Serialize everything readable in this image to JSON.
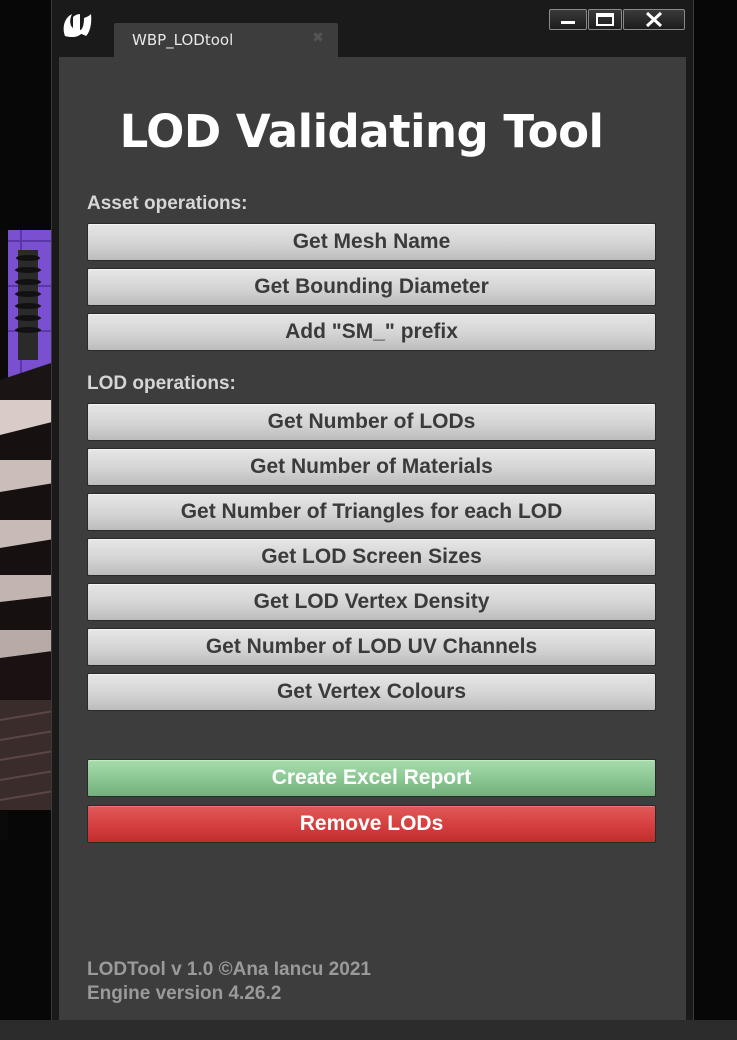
{
  "window": {
    "tab_title": "WBP_LODtool",
    "tab_close_glyph": "✖",
    "controls": [
      "minimize-icon",
      "maximize-icon",
      "close-icon"
    ]
  },
  "tool": {
    "title": "LOD Validating Tool"
  },
  "asset_section": {
    "label": "Asset operations:",
    "buttons": [
      "Get Mesh Name",
      "Get Bounding Diameter",
      "Add \"SM_\" prefix"
    ]
  },
  "lod_section": {
    "label": "LOD operations:",
    "buttons": [
      "Get Number of LODs",
      "Get Number of Materials",
      "Get Number of Triangles for each LOD",
      "Get LOD Screen Sizes",
      "Get LOD Vertex Density",
      "Get Number of LOD UV Channels",
      "Get Vertex Colours"
    ]
  },
  "actions": {
    "create_report": "Create Excel Report",
    "remove_lods": "Remove LODs"
  },
  "footer": {
    "line1": "LODTool v 1.0 ©Ana Iancu 2021",
    "line2": "Engine version 4.26.2"
  },
  "colors": {
    "panel_bg": "#3d3d3d",
    "button_gray": "#d4d4d4",
    "button_green": "#8cc894",
    "button_red": "#d53e3e"
  }
}
